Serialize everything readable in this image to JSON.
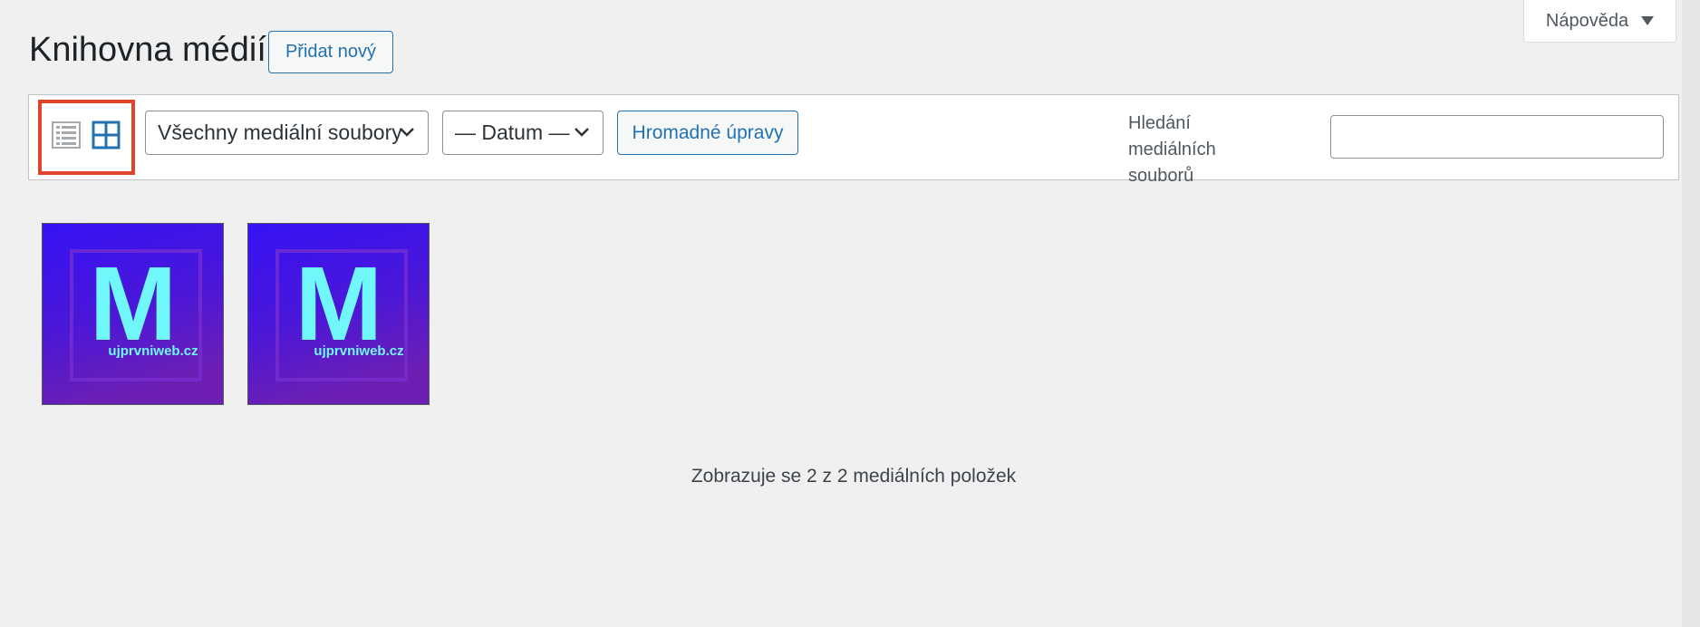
{
  "help": {
    "label": "Nápověda"
  },
  "header": {
    "title": "Knihovna médií",
    "add_new": "Přidat nový"
  },
  "toolbar": {
    "view_modes": [
      {
        "name": "list-view",
        "active": false
      },
      {
        "name": "grid-view",
        "active": true
      }
    ],
    "type_filter": "Všechny mediální soubory",
    "date_filter": "— Datum —",
    "bulk_edit": "Hromadné úpravy",
    "search_label": "Hledání mediálních souborů",
    "search_value": ""
  },
  "media": {
    "items": [
      {
        "letter": "M",
        "caption": "ujprvniweb.cz"
      },
      {
        "letter": "M",
        "caption": "ujprvniweb.cz"
      }
    ],
    "count_text": "Zobrazuje se 2 z 2 mediálních položek"
  },
  "colors": {
    "accent": "#2271b1",
    "highlight": "#e0452c",
    "thumb_bg_top": "#3a10f0",
    "thumb_bg_bottom": "#6a1fb8",
    "thumb_letter": "#6ff7f9"
  }
}
